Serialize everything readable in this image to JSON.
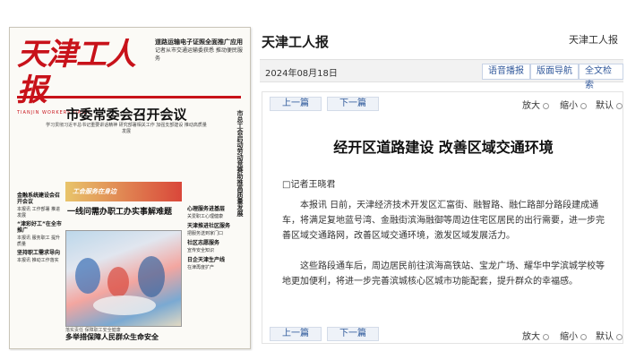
{
  "newspaper": {
    "masthead": "天津工人报",
    "masthead_sub": "TIANJIN WORKERS DAILY",
    "top_right_headline": "道路运输电子证照全面推广应用",
    "top_right_text": "记者从市交通运输委获悉 推动便民服务",
    "headline": "市委常委会召开会议",
    "lead": "学习贯彻习近平总书记重要讲话精神 研究部署相关工作 加强支部建设 推动高质量发展",
    "vertical_column": "市总工会启动劳动竞赛助推高质量发展",
    "left_col": [
      {
        "title": "金融系统建设会召开会议",
        "text": "本报讯 工作部署 推进发展"
      },
      {
        "title": "“津彩好工”在全市推广",
        "text": "本报讯 服务职工 提升质量"
      },
      {
        "title": "坚持职工需求导向",
        "text": "本报讯 推动工作落实"
      }
    ],
    "mid_banner": "工会服务在身边",
    "mid_title": "一线问需办职工办实事解难题",
    "right_col": [
      {
        "title": "心理服务进基层",
        "text": "关爱职工心理健康"
      },
      {
        "title": "天津推进社区服务",
        "text": "把服务送到家门口"
      },
      {
        "title": "社区志愿服务",
        "text": "宣传安全知识"
      },
      {
        "title": "日企天津生产线",
        "text": "在津再度扩产"
      }
    ],
    "bottom_sub": "落实责任 保障职工安全健康",
    "bottom_head": "多举措保障人民群众生命安全"
  },
  "reader": {
    "site_title": "天津工人报",
    "site_title_right": "天津工人报",
    "date": "2024年08月18日",
    "buttons": {
      "audio": "语音播报",
      "layout_nav": "版面导航",
      "full_search": "全文检索"
    },
    "nav": {
      "prev": "上一篇",
      "next": "下一篇"
    },
    "zoom": {
      "in": "放大",
      "out": "缩小",
      "default": "默认"
    },
    "article": {
      "title": "经开区道路建设 改善区域交通环境",
      "byline": "□记者王晓君",
      "paragraphs": [
        "本报讯 日前，天津经济技术开发区汇富街、融智路、融仁路部分路段建成通车，将满足复地蓝号湾、金融街滨海融御等周边住宅区居民的出行需要，进一步完善区域交通路网，改善区域交通环境，激发区域发展活力。",
        "这些路段通车后，周边居民前往滨海高铁站、宝龙广场、耀华中学滨城学校等地更加便利，将进一步完善滨城核心区城市功能配套，提升群众的幸福感。"
      ]
    }
  }
}
